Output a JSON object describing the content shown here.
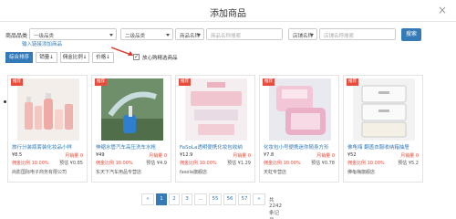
{
  "modal": {
    "title": "添加商品",
    "close": "×"
  },
  "filters": {
    "category_label": "商品品类",
    "category_value": "一级品类",
    "category2_value": "二级品类",
    "name_select": "商品名称",
    "name_placeholder": "商品名称搜索",
    "shop_select": "店铺名称",
    "shop_placeholder": "店铺名称搜索",
    "search_label": "搜索",
    "apply_link": "输入链接添加商品"
  },
  "sort": {
    "comprehensive": "综合排序",
    "sales": "销量",
    "commission_rate": "佣金比例",
    "price": "价格",
    "selected_only_label": "放心购精选商品",
    "selected_only_checked": true
  },
  "products": [
    {
      "tag": "推荐",
      "title": "旅行分装瓶套装化妆品小样",
      "price": "¥8.5",
      "sales_label": "月销量",
      "sales": "0",
      "rate_label": "佣金比例",
      "rate": "10.00%",
      "commission_label": "预估",
      "commission": "¥0.85",
      "shop": "尚影国际电子商务有限公司"
    },
    {
      "tag": "推荐",
      "title": "伸缩水管汽车高压洗车水枪",
      "price": "¥49",
      "sales_label": "月销量",
      "sales": "0",
      "rate_label": "佣金比例",
      "rate": "10.00%",
      "commission_label": "预估",
      "commission": "¥4.9",
      "shop": "东天下汽车用品专营店"
    },
    {
      "tag": "推荐",
      "title": "FaSoLa透明便携化妆包收纳",
      "price": "¥12.9",
      "sales_label": "月销量",
      "sales": "0",
      "rate_label": "佣金比例",
      "rate": "10.00%",
      "commission_label": "预估",
      "commission": "¥1.29",
      "shop": "fasola旗舰店"
    },
    {
      "tag": "推荐",
      "title": "化妆包小号便携迷你随身方形",
      "price": "¥7.8",
      "sales_label": "月销量",
      "sales": "0",
      "rate_label": "佣金比例",
      "rate": "10.00%",
      "commission_label": "预估",
      "commission": "¥0.78",
      "shop": "天虹专营店"
    },
    {
      "tag": "推荐",
      "title": "佛龟嗨 翻盖衣服收纳箱抽屉",
      "price": "¥52",
      "sales_label": "月销量",
      "sales": "0",
      "rate_label": "佣金比例",
      "rate": "10.00%",
      "commission_label": "预估",
      "commission": "¥5.2",
      "shop": "佛龟嗨旗舰店"
    }
  ],
  "pagination": {
    "prev": "«",
    "pages": [
      "1",
      "2",
      "3",
      "...",
      "55",
      "56",
      "57"
    ],
    "active": "1",
    "next": "»",
    "total": "共2242条记录"
  }
}
